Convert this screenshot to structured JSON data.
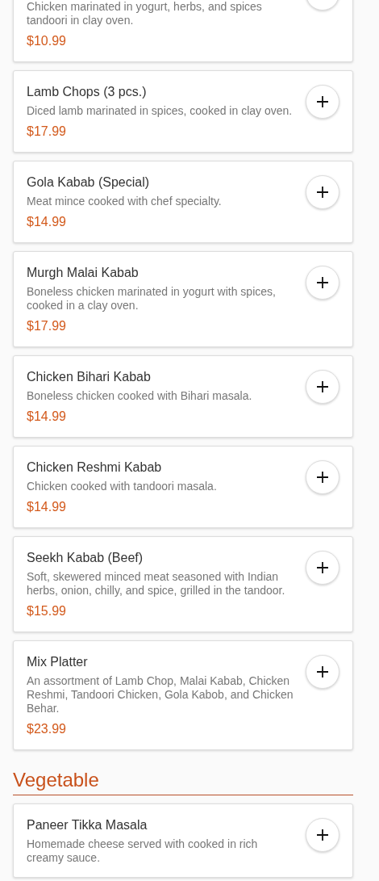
{
  "sections": [
    {
      "items": [
        {
          "description": "Chicken marinated in yogurt, herbs, and spices tandoori in clay oven.",
          "price": "$10.99"
        },
        {
          "name": "Lamb Chops (3 pcs.)",
          "description": "Diced lamb marinated in spices, cooked in clay oven.",
          "price": "$17.99"
        },
        {
          "name": "Gola Kabab (Special)",
          "description": "Meat mince cooked with chef specialty.",
          "price": "$14.99"
        },
        {
          "name": "Murgh Malai Kabab",
          "description": "Boneless chicken marinated in yogurt with spices, cooked in a clay oven.",
          "price": "$17.99"
        },
        {
          "name": "Chicken Bihari Kabab",
          "description": "Boneless chicken cooked with Bihari masala.",
          "price": "$14.99"
        },
        {
          "name": "Chicken Reshmi Kabab",
          "description": "Chicken cooked with tandoori masala.",
          "price": "$14.99"
        },
        {
          "name": "Seekh Kabab (Beef)",
          "description": "Soft, skewered minced meat seasoned with Indian herbs, onion, chilly, and spice, grilled in the tandoor.",
          "price": "$15.99"
        },
        {
          "name": "Mix Platter",
          "description": "An assortment of Lamb Chop, Malai Kabab, Chicken Reshmi, Tandoori Chicken, Gola Kabob, and Chicken Behar.",
          "price": "$23.99"
        }
      ]
    },
    {
      "title": "Vegetable",
      "items": [
        {
          "name": "Paneer Tikka Masala",
          "description": "Homemade cheese served with cooked in rich creamy sauce."
        }
      ]
    }
  ]
}
